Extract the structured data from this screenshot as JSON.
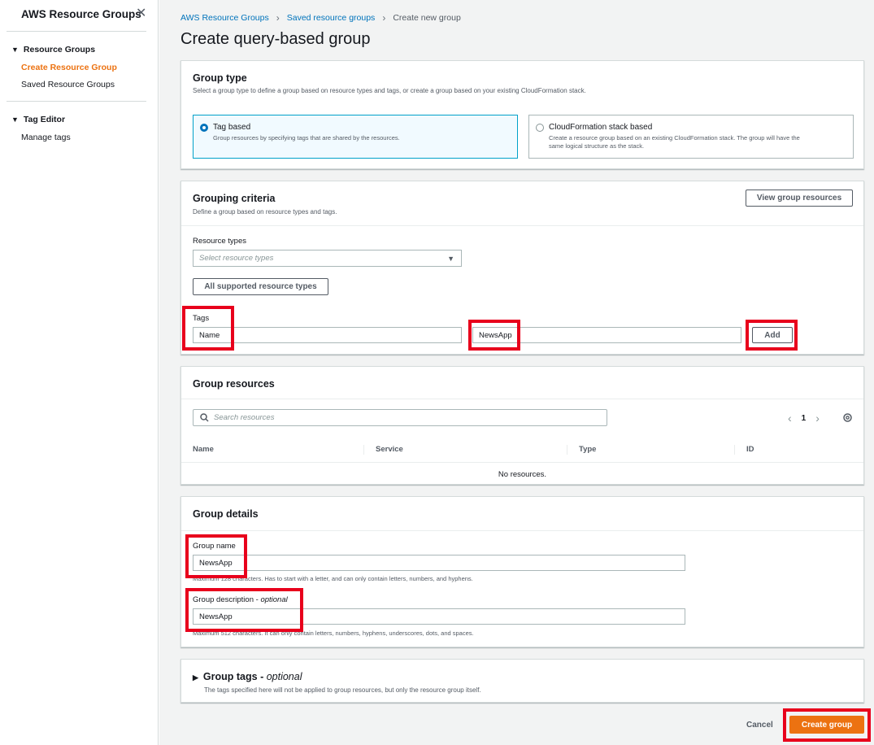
{
  "sidebar": {
    "title": "AWS Resource Groups",
    "sections": [
      {
        "label": "Resource Groups",
        "items": [
          "Create Resource Group",
          "Saved Resource Groups"
        ]
      },
      {
        "label": "Tag Editor",
        "items": [
          "Manage tags"
        ]
      }
    ],
    "active_item": "Create Resource Group"
  },
  "breadcrumb": [
    "AWS Resource Groups",
    "Saved resource groups",
    "Create new group"
  ],
  "page_title": "Create query-based group",
  "group_type": {
    "title": "Group type",
    "description": "Select a group type to define a group based on resource types and tags, or create a group based on your existing CloudFormation stack.",
    "options": [
      {
        "label": "Tag based",
        "description": "Group resources by specifying tags that are shared by the resources.",
        "selected": true
      },
      {
        "label": "CloudFormation stack based",
        "description_line1": "Create a resource group based on an existing CloudFormation stack. The group will have the",
        "description_line2": "same logical structure as the stack.",
        "selected": false
      }
    ]
  },
  "grouping_criteria": {
    "title": "Grouping criteria",
    "description": "Define a group based on resource types and tags.",
    "view_button": "View group resources",
    "resource_types_label": "Resource types",
    "resource_types_placeholder": "Select resource types",
    "all_types_button": "All supported resource types",
    "tags_label": "Tags",
    "tag_key": "Name",
    "tag_value": "NewsApp",
    "add_button": "Add"
  },
  "group_resources": {
    "title": "Group resources",
    "search_placeholder": "Search resources",
    "page": "1",
    "columns": [
      "Name",
      "Service",
      "Type",
      "ID"
    ],
    "empty_text": "No resources."
  },
  "group_details": {
    "title": "Group details",
    "name_label": "Group name",
    "name_value": "NewsApp",
    "name_hint": "Maximum 128 characters. Has to start with a letter, and can only contain letters, numbers, and hyphens.",
    "desc_label": "Group description - ",
    "desc_label_optional": "optional",
    "desc_value": "NewsApp",
    "desc_hint": "Maximum 512 characters. It can only contain letters, numbers, hyphens, underscores, dots, and spaces."
  },
  "group_tags": {
    "title": "Group tags - ",
    "title_optional": "optional",
    "description": "The tags specified here will not be applied to group resources, but only the resource group itself."
  },
  "footer": {
    "cancel": "Cancel",
    "create": "Create group"
  },
  "colors": {
    "accent": "#ec7211",
    "link": "#0073bb",
    "highlight": "#e8001c"
  }
}
